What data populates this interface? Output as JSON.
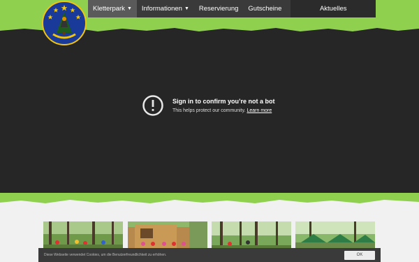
{
  "nav": {
    "items": [
      {
        "label": "Kletterpark",
        "has_dropdown": true,
        "active": true
      },
      {
        "label": "Informationen",
        "has_dropdown": true,
        "active": false
      },
      {
        "label": "Reservierung",
        "has_dropdown": false,
        "active": false
      },
      {
        "label": "Gutscheine",
        "has_dropdown": false,
        "active": false
      }
    ],
    "news_label": "Aktuelles",
    "dropdown_icon": "chevron-down-icon"
  },
  "logo": {
    "icon": "kletterwald-logo",
    "ring_color": "#f1c40f",
    "field_color": "#1a3a9a"
  },
  "video_notice": {
    "title": "Sign in to confirm you’re not a bot",
    "subtitle": "This helps protect our community.",
    "link": "Learn more",
    "icon": "alert-circle-icon"
  },
  "gallery": {
    "thumbs": [
      {
        "alt": "forest-group-photo"
      },
      {
        "alt": "wooden-hut-photo"
      },
      {
        "alt": "forest-climbing-photo"
      },
      {
        "alt": "tents-photo"
      }
    ]
  },
  "cookie": {
    "text": "Diese Webseite verwendet Cookies, um die Benutzerfreundlichkeit zu erhöhen.",
    "ok_label": "OK"
  },
  "colors": {
    "accent_green": "#8fd14f",
    "nav_bg": "#3a3a3a",
    "video_bg": "#262626"
  }
}
